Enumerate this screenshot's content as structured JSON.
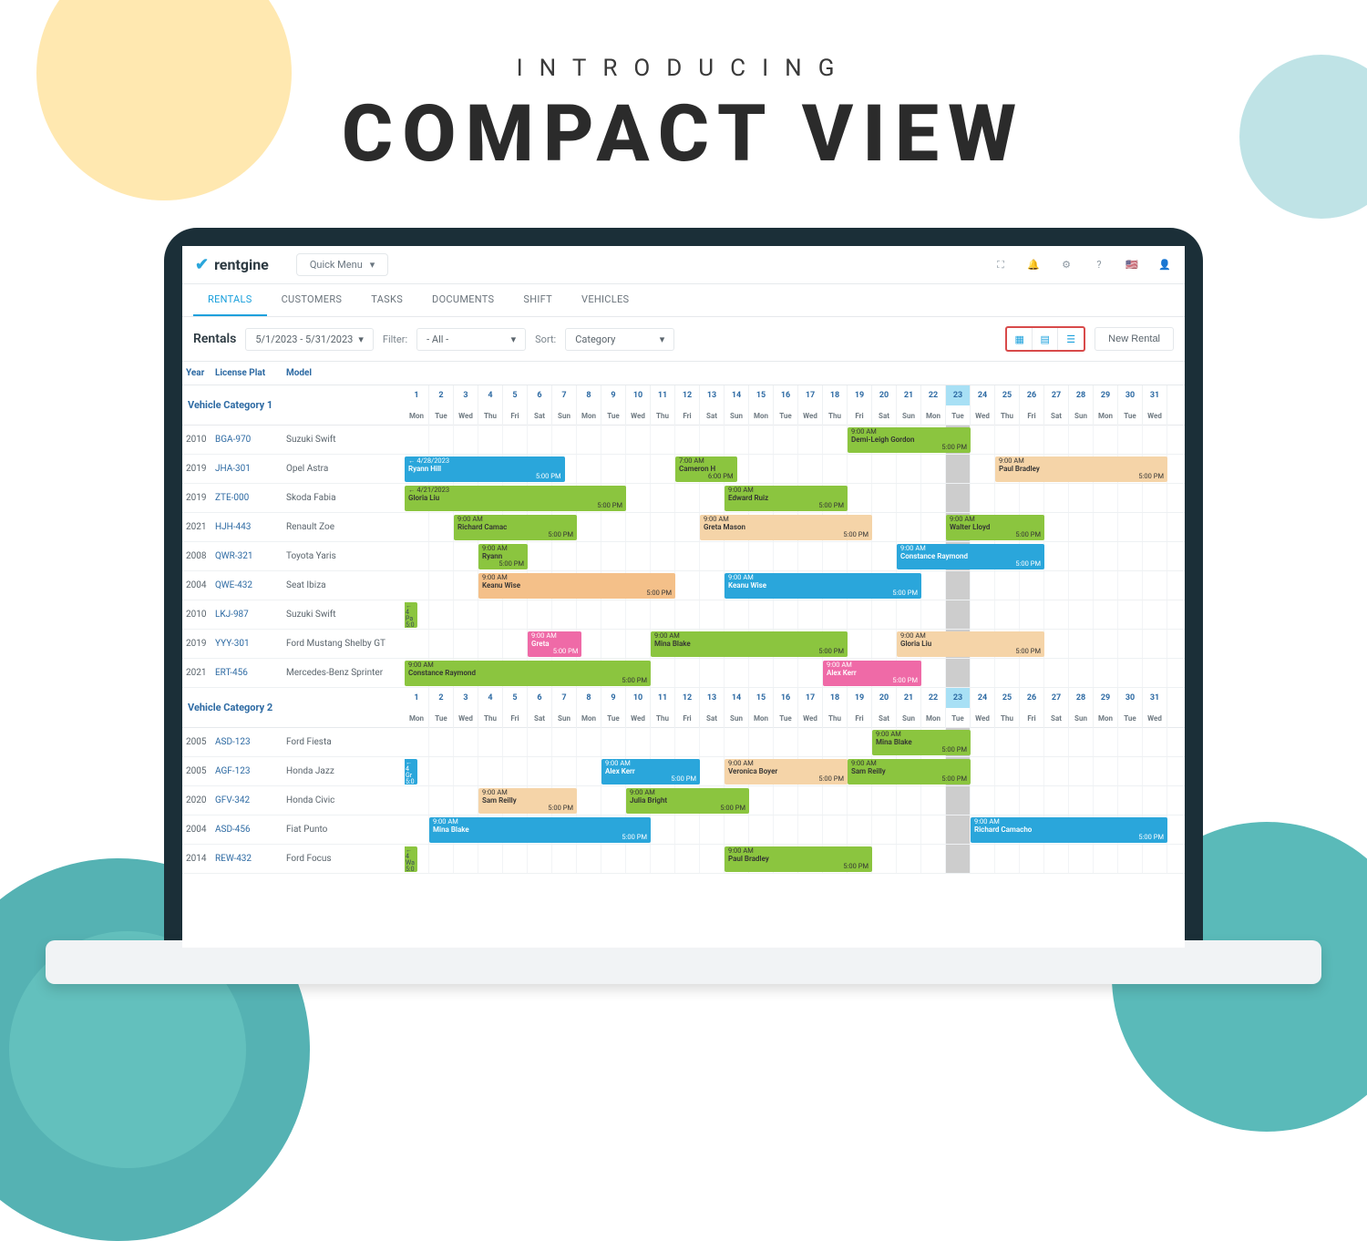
{
  "hero": {
    "intro": "INTRODUCING",
    "title": "COMPACT VIEW"
  },
  "brand": "rentgine",
  "quick_menu": "Quick Menu",
  "nav_tabs": [
    "RENTALS",
    "CUSTOMERS",
    "TASKS",
    "DOCUMENTS",
    "SHIFT",
    "VEHICLES"
  ],
  "toolbar": {
    "title": "Rentals",
    "date_range": "5/1/2023 - 5/31/2023",
    "filter_label": "Filter:",
    "filter_value": "- All -",
    "sort_label": "Sort:",
    "sort_value": "Category",
    "new_rental": "New Rental"
  },
  "columns": {
    "year": "Year",
    "plate": "License Plat",
    "model": "Model"
  },
  "days": 31,
  "today": 23,
  "dows": [
    "Mon",
    "Tue",
    "Wed",
    "Thu",
    "Fri",
    "Sat",
    "Sun",
    "Mon",
    "Tue",
    "Wed",
    "Thu",
    "Fri",
    "Sat",
    "Sun",
    "Mon",
    "Tue",
    "Wed",
    "Thu",
    "Fri",
    "Sat",
    "Sun",
    "Mon",
    "Tue",
    "Wed",
    "Thu",
    "Fri",
    "Sat",
    "Sun",
    "Mon",
    "Tue",
    "Wed"
  ],
  "categories": [
    {
      "name": "Vehicle Category 1",
      "vehicles": [
        {
          "year": "2010",
          "plate": "BGA-970",
          "model": "Suzuki Swift",
          "bars": [
            {
              "start": 19,
              "end": 23,
              "name": "Demi-Leigh Gordon",
              "t1": "9:00 AM",
              "t2": "5:00 PM",
              "c": "c-green"
            }
          ]
        },
        {
          "year": "2019",
          "plate": "JHA-301",
          "model": "Opel Astra",
          "bars": [
            {
              "start": 1,
              "end": 6.5,
              "name": "Ryann Hill",
              "t1": "← 4/28/2023",
              "t2": "5:00 PM",
              "c": "c-blue"
            },
            {
              "start": 12,
              "end": 13.5,
              "name": "Cameron H",
              "t1": "7:00 AM",
              "t2": "6:00 PM",
              "c": "c-green"
            },
            {
              "start": 25,
              "end": 31,
              "name": "Paul Bradley",
              "t1": "9:00 AM",
              "t2": "5:00 PM",
              "c": "c-peach"
            }
          ]
        },
        {
          "year": "2019",
          "plate": "ZTE-000",
          "model": "Skoda Fabia",
          "bars": [
            {
              "start": 1,
              "end": 9,
              "name": "Gloria Liu",
              "t1": "← 4/21/2023",
              "t2": "5:00 PM",
              "c": "c-green"
            },
            {
              "start": 14,
              "end": 18,
              "name": "Edward Ruiz",
              "t1": "9:00 AM",
              "t2": "5:00 PM",
              "c": "c-green"
            }
          ]
        },
        {
          "year": "2021",
          "plate": "HJH-443",
          "model": "Renault Zoe",
          "bars": [
            {
              "start": 3,
              "end": 7,
              "name": "Richard Camac",
              "t1": "9:00 AM",
              "t2": "5:00 PM",
              "c": "c-green"
            },
            {
              "start": 13,
              "end": 19,
              "name": "Greta Mason",
              "t1": "9:00 AM",
              "t2": "5:00 PM",
              "c": "c-peach"
            },
            {
              "start": 23,
              "end": 26,
              "name": "Walter Lloyd",
              "t1": "9:00 AM",
              "t2": "5:00 PM",
              "c": "c-green"
            }
          ]
        },
        {
          "year": "2008",
          "plate": "QWR-321",
          "model": "Toyota Yaris",
          "bars": [
            {
              "start": 4,
              "end": 5,
              "name": "Ryann",
              "t1": "9:00 AM",
              "t2": "5:00 PM",
              "c": "c-green"
            },
            {
              "start": 21,
              "end": 26,
              "name": "Constance Raymond",
              "t1": "9:00 AM",
              "t2": "5:00 PM",
              "c": "c-blue"
            }
          ]
        },
        {
          "year": "2004",
          "plate": "QWE-432",
          "model": "Seat Ibiza",
          "bars": [
            {
              "start": 4,
              "end": 11,
              "name": "Keanu Wise",
              "t1": "9:00 AM",
              "t2": "5:00 PM",
              "c": "c-orange"
            },
            {
              "start": 14,
              "end": 21,
              "name": "Keanu Wise",
              "t1": "9:00 AM",
              "t2": "5:00 PM",
              "c": "c-blue"
            }
          ]
        },
        {
          "year": "2010",
          "plate": "LKJ-987",
          "model": "Suzuki Swift",
          "bars": [],
          "stub": {
            "name": "Pa",
            "t1": "← 4",
            "t2": "5:0",
            "c": "c-green"
          }
        },
        {
          "year": "2019",
          "plate": "YYY-301",
          "model": "Ford Mustang Shelby GT",
          "bars": [
            {
              "start": 6,
              "end": 7.2,
              "name": "Greta",
              "t1": "9:00 AM",
              "t2": "5:00 PM",
              "c": "c-pink"
            },
            {
              "start": 11,
              "end": 18,
              "name": "Mina Blake",
              "t1": "9:00 AM",
              "t2": "5:00 PM",
              "c": "c-green"
            },
            {
              "start": 21,
              "end": 26,
              "name": "Gloria Liu",
              "t1": "9:00 AM",
              "t2": "5:00 PM",
              "c": "c-peach"
            }
          ]
        },
        {
          "year": "2021",
          "plate": "ERT-456",
          "model": "Mercedes-Benz Sprinter",
          "bars": [
            {
              "start": 1,
              "end": 10,
              "name": "Constance Raymond",
              "t1": "9:00 AM",
              "t2": "5:00 PM",
              "c": "c-green"
            },
            {
              "start": 18,
              "end": 21,
              "name": "Alex Kerr",
              "t1": "9:00 AM",
              "t2": "5:00 PM",
              "c": "c-pink"
            }
          ]
        }
      ]
    },
    {
      "name": "Vehicle Category 2",
      "vehicles": [
        {
          "year": "2005",
          "plate": "ASD-123",
          "model": "Ford Fiesta",
          "bars": [
            {
              "start": 20,
              "end": 23,
              "name": "Mina Blake",
              "t1": "9:00 AM",
              "t2": "5:00 PM",
              "c": "c-green"
            }
          ]
        },
        {
          "year": "2005",
          "plate": "AGF-123",
          "model": "Honda Jazz",
          "bars": [
            {
              "start": 9,
              "end": 12,
              "name": "Alex Kerr",
              "t1": "9:00 AM",
              "t2": "5:00 PM",
              "c": "c-blue"
            },
            {
              "start": 14,
              "end": 18,
              "name": "Veronica Boyer",
              "t1": "9:00 AM",
              "t2": "5:00 PM",
              "c": "c-peach"
            },
            {
              "start": 19,
              "end": 23,
              "name": "Sam Reilly",
              "t1": "9:00 AM",
              "t2": "5:00 PM",
              "c": "c-green"
            }
          ],
          "stub": {
            "name": "Gr",
            "t1": "← 4",
            "t2": "5:0",
            "c": "c-blue"
          }
        },
        {
          "year": "2020",
          "plate": "GFV-342",
          "model": "Honda Civic",
          "bars": [
            {
              "start": 4,
              "end": 7,
              "name": "Sam Reilly",
              "t1": "9:00 AM",
              "t2": "5:00 PM",
              "c": "c-peach"
            },
            {
              "start": 10,
              "end": 14,
              "name": "Julia Bright",
              "t1": "9:00 AM",
              "t2": "5:00 PM",
              "c": "c-green"
            }
          ]
        },
        {
          "year": "2004",
          "plate": "ASD-456",
          "model": "Fiat Punto",
          "bars": [
            {
              "start": 2,
              "end": 10,
              "name": "Mina Blake",
              "t1": "9:00 AM",
              "t2": "5:00 PM",
              "c": "c-blue"
            },
            {
              "start": 24,
              "end": 31,
              "name": "Richard Camacho",
              "t1": "9:00 AM",
              "t2": "5:00 PM",
              "c": "c-blue"
            }
          ]
        },
        {
          "year": "2014",
          "plate": "REW-432",
          "model": "Ford Focus",
          "bars": [
            {
              "start": 14,
              "end": 19,
              "name": "Paul Bradley",
              "t1": "9:00 AM",
              "t2": "5:00 PM",
              "c": "c-green"
            }
          ],
          "stub": {
            "name": "Wa",
            "t1": "← 4",
            "t2": "5:0",
            "c": "c-green"
          }
        }
      ]
    }
  ]
}
